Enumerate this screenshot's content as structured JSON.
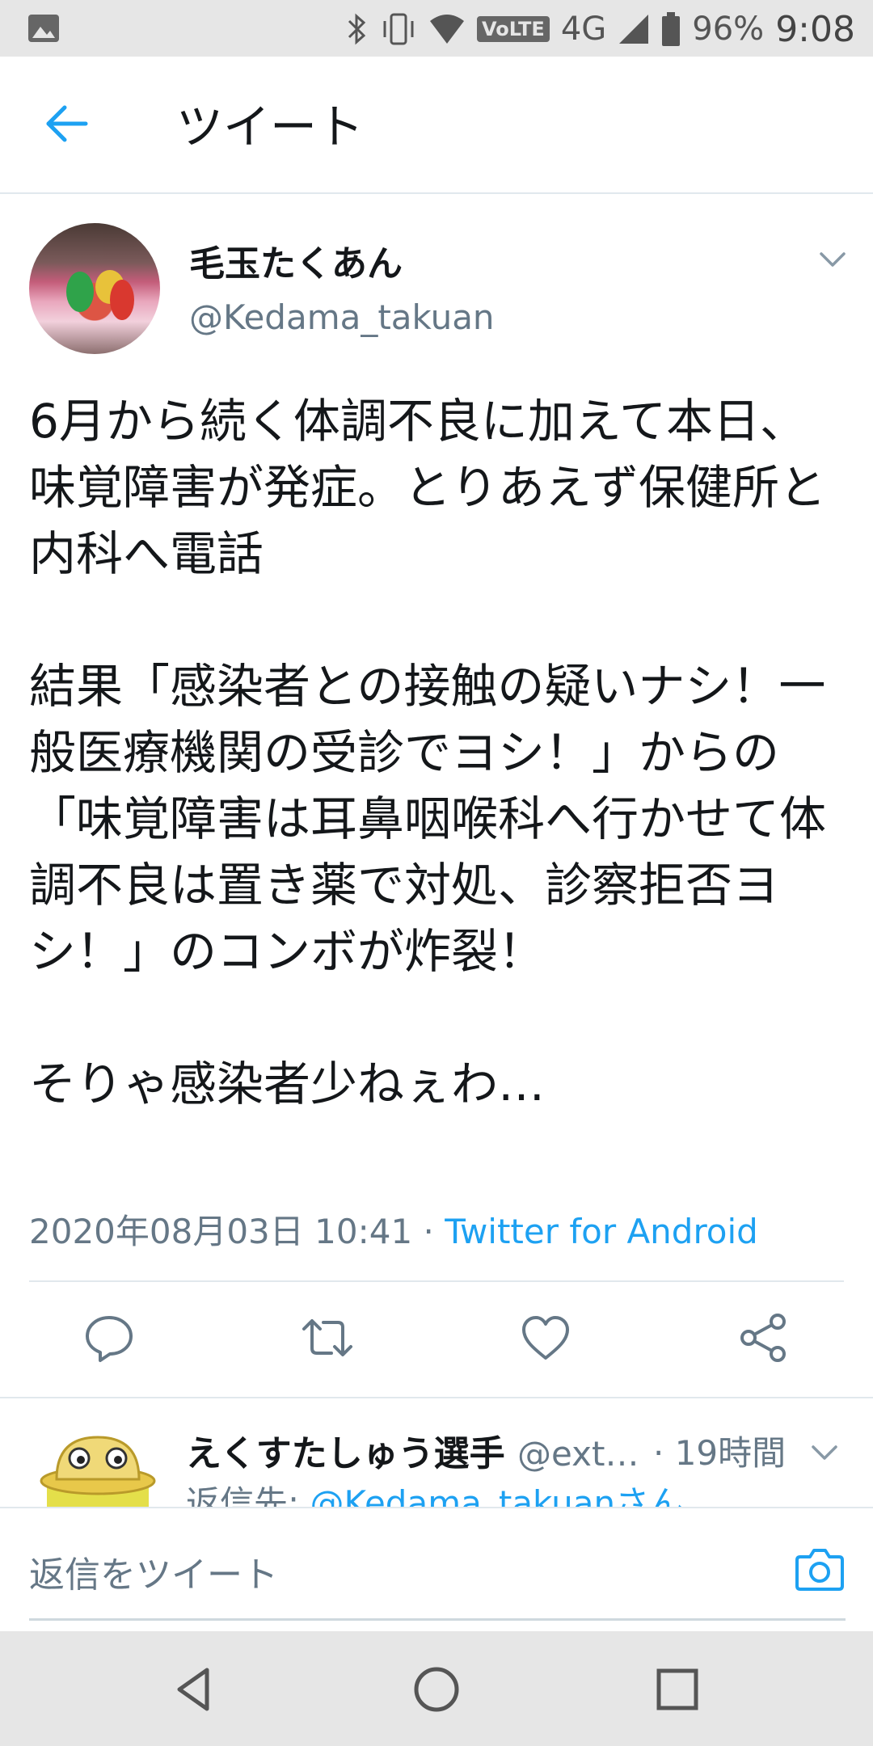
{
  "status_bar": {
    "battery": "96%",
    "time": "9:08",
    "network": "4G",
    "volte": "VoLTE"
  },
  "app_bar": {
    "title": "ツイート"
  },
  "tweet": {
    "display_name": "毛玉たくあん",
    "handle": "@Kedama_takuan",
    "text": "6月から続く体調不良に加えて本日、味覚障害が発症。とりあえず保健所と内科へ電話\n\n結果「感染者との接触の疑いナシ！一般医療機関の受診でヨシ！」からの「味覚障害は耳鼻咽喉科へ行かせて体調不良は置き薬で対処、診察拒否ヨシ！」のコンボが炸裂！\n\nそりゃ感染者少ねぇわ…",
    "timestamp": "2020年08月03日 10:41",
    "separator": " · ",
    "source": "Twitter for Android"
  },
  "actions": {
    "reply_icon": "comment-icon",
    "retweet_icon": "retweet-icon",
    "like_icon": "heart-icon",
    "share_icon": "share-icon"
  },
  "reply": {
    "display_name": "えくすたしゅう選手",
    "handle": "@ext…",
    "time": "· 19時間",
    "reply_to_prefix": "返信先: ",
    "reply_to_mention": "@Kedama_takuanさん"
  },
  "compose": {
    "placeholder": "返信をツイート"
  },
  "colors": {
    "accent": "#1da1f2",
    "muted": "#657786",
    "text": "#14171a"
  }
}
